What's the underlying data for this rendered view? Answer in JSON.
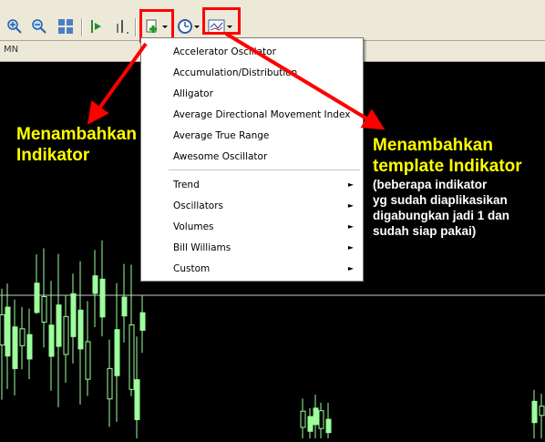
{
  "toolbar": {
    "icons": [
      "zoom-in",
      "zoom-out",
      "tile-windows",
      "chart-shift",
      "auto-scroll",
      "indicators",
      "periods",
      "templates"
    ],
    "period_label": "MN"
  },
  "menu": {
    "items": [
      {
        "label": "Accelerator Oscillator",
        "submenu": false
      },
      {
        "label": "Accumulation/Distribution",
        "submenu": false
      },
      {
        "label": "Alligator",
        "submenu": false
      },
      {
        "label": "Average Directional Movement Index",
        "submenu": false
      },
      {
        "label": "Average True Range",
        "submenu": false
      },
      {
        "label": "Awesome Oscillator",
        "submenu": false
      },
      {
        "label": "Trend",
        "submenu": true
      },
      {
        "label": "Oscillators",
        "submenu": true
      },
      {
        "label": "Volumes",
        "submenu": true
      },
      {
        "label": "Bill Williams",
        "submenu": true
      },
      {
        "label": "Custom",
        "submenu": true
      }
    ]
  },
  "annotations": {
    "left_title_1": "Menambahkan",
    "left_title_2": "Indikator",
    "right_title_1": "Menambahkan",
    "right_title_2": "template Indikator",
    "right_desc_1": "(beberapa indikator",
    "right_desc_2": "yg sudah diaplikasikan",
    "right_desc_3": "digabungkan jadi 1 dan",
    "right_desc_4": "sudah siap pakai)"
  },
  "colors": {
    "annotation_yellow": "#ffff00",
    "highlight_red": "#ff0000",
    "candle_green": "#9cff9c",
    "chart_background": "#000000"
  }
}
